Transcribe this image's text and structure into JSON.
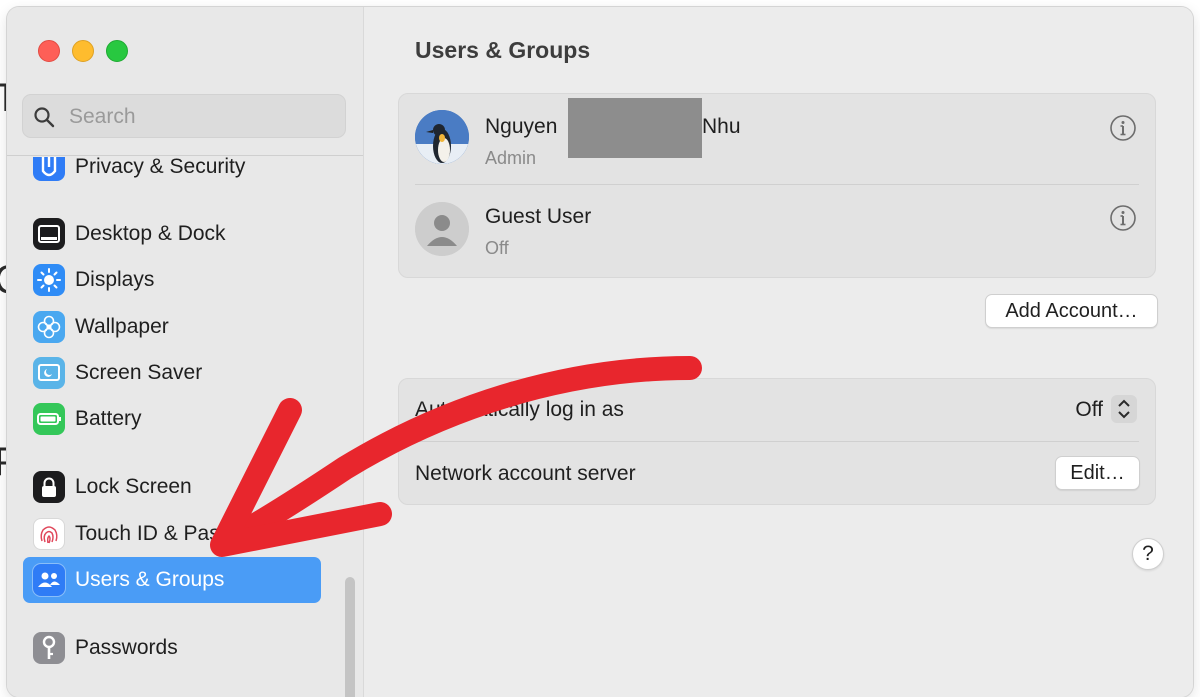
{
  "search": {
    "placeholder": "Search"
  },
  "sidebar": {
    "items": [
      {
        "label": "Privacy & Security",
        "icon": "hand-icon",
        "color": "#2f7cf6"
      },
      {
        "label": "Desktop & Dock",
        "icon": "dock-icon",
        "color": "#1c1c1e"
      },
      {
        "label": "Displays",
        "icon": "sun-icon",
        "color": "#2f8cf6"
      },
      {
        "label": "Wallpaper",
        "icon": "flower-icon",
        "color": "#4aa8f0"
      },
      {
        "label": "Screen Saver",
        "icon": "screen-saver-icon",
        "color": "#5ab4e8"
      },
      {
        "label": "Battery",
        "icon": "battery-icon",
        "color": "#34c759"
      },
      {
        "label": "Lock Screen",
        "icon": "lock-icon",
        "color": "#1c1c1e"
      },
      {
        "label": "Touch ID & Password",
        "icon": "fingerprint-icon",
        "color": "#ffffff"
      },
      {
        "label": "Users & Groups",
        "icon": "users-icon",
        "color": "#2f7cf6",
        "selected": true
      },
      {
        "label": "Passwords",
        "icon": "key-icon",
        "color": "#8e8e93"
      }
    ]
  },
  "main": {
    "title": "Users & Groups",
    "users": [
      {
        "first": "Nguyen",
        "last": "Nhu",
        "role": "Admin",
        "avatar": "penguin-avatar"
      },
      {
        "name": "Guest User",
        "status": "Off",
        "avatar": "generic-person-avatar"
      }
    ],
    "add_account_label": "Add Account…",
    "settings": {
      "auto_login_label": "Automatically log in as",
      "auto_login_value": "Off",
      "network_label": "Network account server",
      "edit_label": "Edit…"
    },
    "help_label": "?"
  },
  "colors": {
    "accent": "#4a9cf6",
    "annotation_arrow": "#e8262d"
  }
}
